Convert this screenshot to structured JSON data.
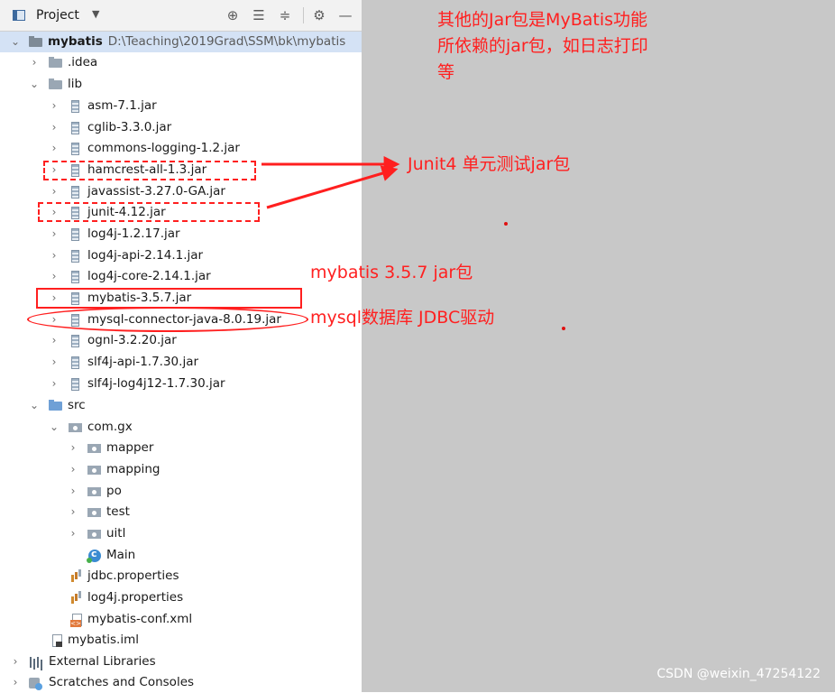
{
  "toolwindow": {
    "title": "Project",
    "dropdown_icon": "chevron-down-icon"
  },
  "tree": {
    "root": {
      "label": "mybatis",
      "path": "D:\\Teaching\\2019Grad\\SSM\\bk\\mybatis"
    },
    "idea": ".idea",
    "lib": {
      "label": "lib",
      "jars": [
        "asm-7.1.jar",
        "cglib-3.3.0.jar",
        "commons-logging-1.2.jar",
        "hamcrest-all-1.3.jar",
        "javassist-3.27.0-GA.jar",
        "junit-4.12.jar",
        "log4j-1.2.17.jar",
        "log4j-api-2.14.1.jar",
        "log4j-core-2.14.1.jar",
        "mybatis-3.5.7.jar",
        "mysql-connector-java-8.0.19.jar",
        "ognl-3.2.20.jar",
        "slf4j-api-1.7.30.jar",
        "slf4j-log4j12-1.7.30.jar"
      ]
    },
    "src": {
      "label": "src",
      "package": "com.gx",
      "subpackages": [
        "mapper",
        "mapping",
        "po",
        "test",
        "uitl"
      ],
      "main_class": "Main",
      "files": [
        "jdbc.properties",
        "log4j.properties",
        "mybatis-conf.xml"
      ]
    },
    "iml": "mybatis.iml",
    "external_libraries": "External Libraries",
    "scratches": "Scratches and Consoles"
  },
  "annotations": {
    "dependency_note": [
      "其他的Jar包是MyBatis功能",
      "所依赖的jar包，如日志打印",
      "等"
    ],
    "junit_note": "Junit4 单元测试jar包",
    "mybatis_note": "mybatis 3.5.7 jar包",
    "mysql_note": "mysql数据库 JDBC驱动",
    "color": "#ff2020"
  },
  "watermark": "CSDN @weixin_47254122"
}
